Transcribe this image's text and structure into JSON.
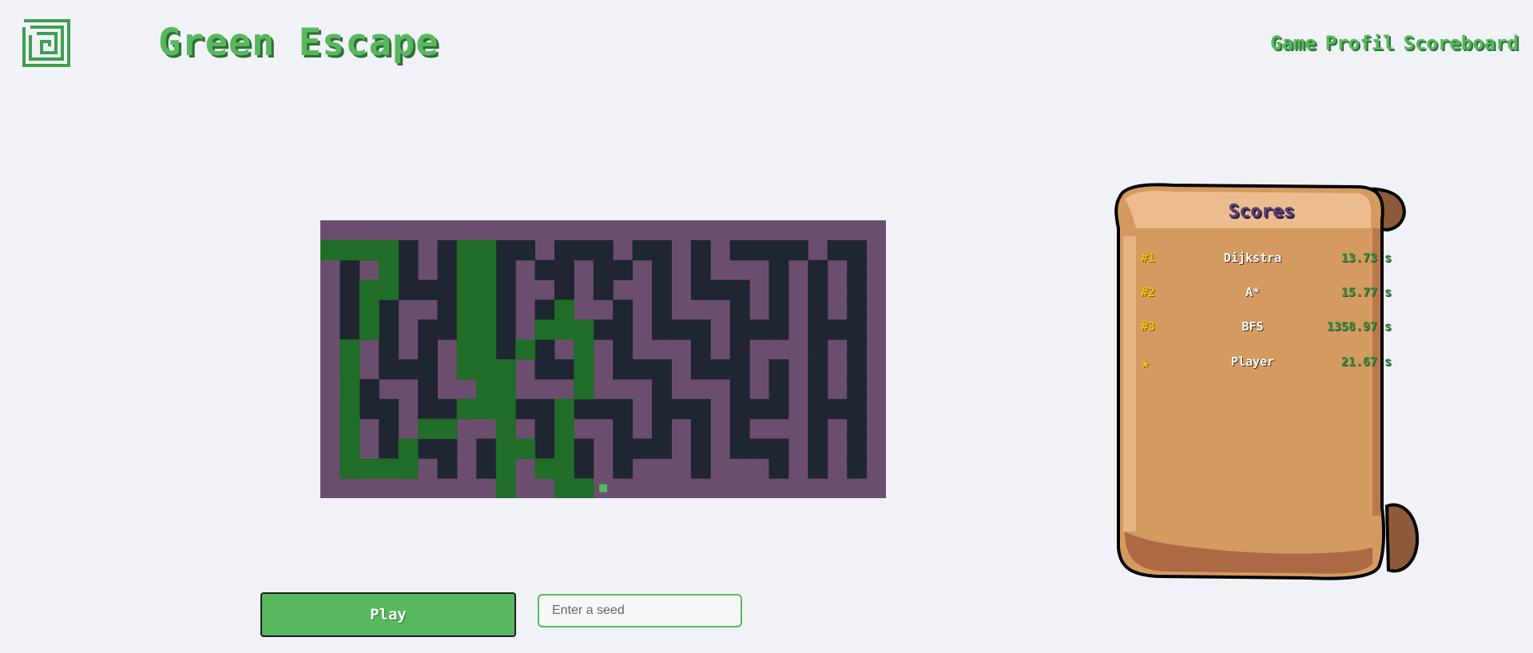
{
  "header": {
    "title": "Green Escape",
    "logo_icon": "maze-logo-icon",
    "nav": [
      {
        "label": "Game"
      },
      {
        "label": "Profil"
      },
      {
        "label": "Scoreboard"
      }
    ]
  },
  "controls": {
    "play_label": "Play",
    "seed_placeholder": "Enter a seed",
    "seed_value": ""
  },
  "scoreboard": {
    "title": "Scores",
    "entries": [
      {
        "rank": "#1",
        "name": "Dijkstra",
        "time": "13.73 s"
      },
      {
        "rank": "#2",
        "name": "A*",
        "time": "15.77 s"
      },
      {
        "rank": "#3",
        "name": "BFS",
        "time": "1358.97 s"
      }
    ],
    "player": {
      "icon": "★",
      "name": "Player",
      "time": "21.67 s"
    }
  },
  "maze": {
    "cols": 29,
    "rows": 14,
    "colors": {
      "wall": "#6b4e6e",
      "floor": "#1f2531",
      "path": "#1f6d26",
      "player": "#57b85e"
    },
    "grid": [
      "#############################",
      "#..#.#.#...#...#..#.#....#..#",
      "#.##.#.##.#..#..#.#.###.#.#.#",
      "#..#...#..##.#.##.#...#.#.#.#",
      "#.#.##.##.#..##.#.###.#.#.#.#",
      "#...#...#.#.#...#...#...#...#",
      "#.#.#.#.#.#.#.#.###.#.###.#.#",
      "#.#...#...#...#...#...#.#.#.#",
      "##.##.###.###.###.###.#.#.#.#",
      "#...#...#...#...#...#...#...#",
      "#.#.##.##.#.###.#.#.#.###.#.#",
      "#.#....#..#...#...#.#...#.#.#",
      "#.##.#.#.####.#.###.###.#.#.#",
      "#############################"
    ],
    "solution": [
      [
        1,
        0
      ],
      [
        1,
        1
      ],
      [
        1,
        2
      ],
      [
        1,
        3
      ],
      [
        2,
        3
      ],
      [
        3,
        3
      ],
      [
        3,
        2
      ],
      [
        4,
        2
      ],
      [
        5,
        2
      ],
      [
        6,
        1
      ],
      [
        7,
        1
      ],
      [
        8,
        1
      ],
      [
        9,
        1
      ],
      [
        10,
        1
      ],
      [
        11,
        1
      ],
      [
        12,
        1
      ],
      [
        12,
        2
      ],
      [
        12,
        3
      ],
      [
        12,
        4
      ],
      [
        11,
        4
      ],
      [
        10,
        5
      ],
      [
        10,
        6
      ],
      [
        9,
        7
      ],
      [
        8,
        8
      ],
      [
        7,
        9
      ],
      [
        6,
        10
      ],
      [
        5,
        11
      ],
      [
        4,
        12
      ],
      [
        5,
        12
      ],
      [
        5,
        13
      ],
      [
        6,
        13
      ],
      [
        7,
        13
      ],
      [
        8,
        13
      ],
      [
        9,
        12
      ],
      [
        10,
        12
      ],
      [
        11,
        12
      ],
      [
        12,
        12
      ],
      [
        13,
        13
      ],
      [
        14,
        13
      ],
      [
        13,
        12
      ],
      [
        12,
        11
      ],
      [
        11,
        10
      ],
      [
        10,
        9
      ],
      [
        9,
        8
      ],
      [
        8,
        8
      ],
      [
        7,
        8
      ],
      [
        6,
        8
      ],
      [
        5,
        8
      ],
      [
        4,
        8
      ],
      [
        3,
        8
      ],
      [
        2,
        8
      ],
      [
        1,
        8
      ],
      [
        1,
        7
      ],
      [
        2,
        7
      ],
      [
        3,
        7
      ],
      [
        4,
        7
      ],
      [
        5,
        7
      ],
      [
        6,
        7
      ],
      [
        7,
        7
      ],
      [
        7,
        8
      ],
      [
        8,
        9
      ],
      [
        9,
        9
      ],
      [
        10,
        9
      ],
      [
        11,
        9
      ],
      [
        12,
        9
      ],
      [
        13,
        9
      ],
      [
        14,
        9
      ],
      [
        14,
        10
      ],
      [
        14,
        11
      ],
      [
        13,
        12
      ]
    ],
    "player_pos": [
      13,
      14
    ]
  }
}
